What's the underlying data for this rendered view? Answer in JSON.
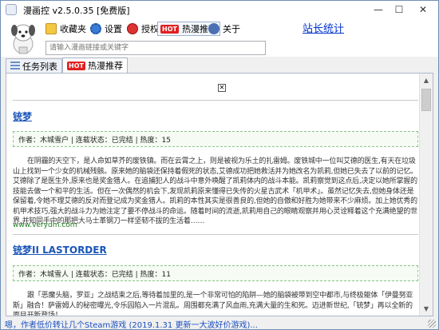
{
  "window": {
    "title": "漫画控 v2.5.0.35 [免费版]",
    "minimize_glyph": "—",
    "maximize_glyph": "☐",
    "close_glyph": "✕"
  },
  "toolbar": {
    "favorites_label": "收藏夹",
    "settings_label": "设置",
    "authorize_label": "授权",
    "hot_badge": "HOT",
    "hot_recommend_label": "热漫推荐",
    "about_label": "关于",
    "stats_link": "站长统计"
  },
  "search": {
    "placeholder": "请输入漫画链接或关键字",
    "value": ""
  },
  "tabs": [
    {
      "label": "任务列表"
    },
    {
      "label": "热漫推荐",
      "badge": "HOT"
    }
  ],
  "content": {
    "broken_image_glyph": "✕",
    "items": [
      {
        "title": "铳梦",
        "info": "作者：木城雪户 | 连载状态：已完结 | 热度：15",
        "description": "在阴霾的天空下，是人命如草芥的废铁镇。而在云霄之上，则是被视为乐土的扎雷姆。废铁城中一位叫艾德的医生,有天在垃圾山上找到一个少女的机械残骸。原来她的脑袋还保持着假死的状态,艾德成功把她救活并为她改名为凯莉,但她已失去了以前的记忆。艾德除了是医生外,原来也是奖金猎人。在追捕犯人的战斗中意外唤醒了凯莉体内的战斗本能。凯莉察觉到这点后,决定以她所掌握的技能去做一个和平的生活。但在一次偶然的机会下,发现凯莉原来懂得已失传的火星古武术「机甲术」。虽然记忆失去,但她身体还是保留着,令她不理艾德的反对而登记成为奖金猎人。凯莉的本性其实是很善良的,但她的自傲和好胜为她带来不少麻烦。加上她优秀的机甲术技巧,强大的战斗力为她注定了要不停战斗的命运。随着时间的流逝,凯莉用自己的眼睛观察并用心灵诠释着这个充满绝望的世界,并知同手中的那把大马士革钢刀一样坚韧不拔的生活着……",
        "site": "www.verydm.com"
      },
      {
        "title": "铳梦II LASTORDER",
        "info": "作者：木城雪人 | 连载状态：已完结 | 热度：11",
        "description": "跟「恶魔头脑，罗亚」之战结束之后,等待着加里的,是一个非常可怕的陷阱—她的脑袋被带到空中都市,与终极躯体「伊曼努亚斯」融合！萨雷姆人的秘密曝光,令乐园陷入一片混乱。周围都充满了风血雨,充满大量的生和死。迈进新世纪,「铳梦」再以全新的面目开新登场！"
      }
    ]
  },
  "status": {
    "text": "嗯，作者低价转让几个Steam游戏 (2019.1.31 更新一大波好价游戏)..."
  }
}
